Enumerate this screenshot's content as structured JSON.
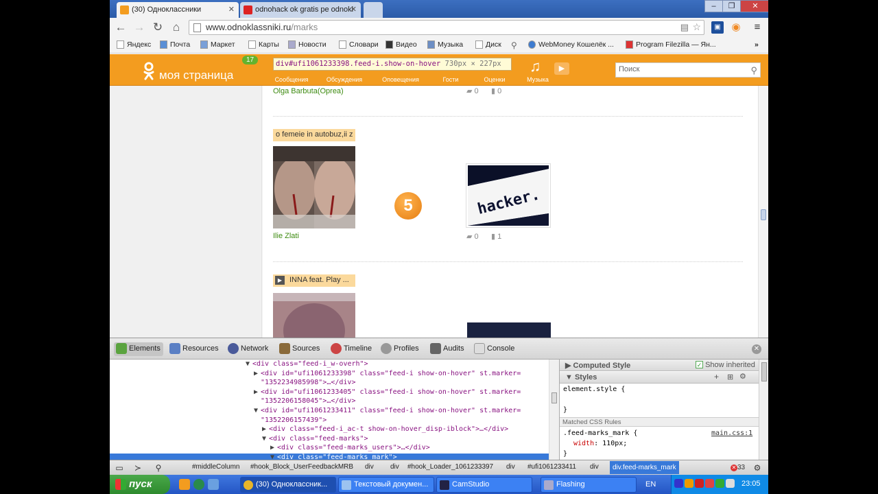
{
  "browser": {
    "tabs": [
      {
        "title": "(30) Одноклассники",
        "active": true
      },
      {
        "title": "odnohack ok gratis pe odnokl",
        "active": false
      }
    ],
    "url_host": "www.odnoklassniki.ru",
    "url_path": "/marks",
    "bookmarks": [
      "Яндекс",
      "Почта",
      "Маркет",
      "Карты",
      "Новости",
      "Словари",
      "Видео",
      "Музыка",
      "Диск",
      "WebMoney Кошелёк ...",
      "Program Filezilla — Ян..."
    ],
    "overflow_label": "»"
  },
  "ok": {
    "logo_text": "моя страница",
    "badge": "17",
    "nav": [
      "Сообщения",
      "Обсуждения",
      "Оповещения",
      "Гости",
      "Оценки",
      "Музыка"
    ],
    "search_placeholder": "Поиск",
    "inspector_tip": {
      "selector": "div#ufi1061233398.feed-i.show-on-hover",
      "size": "730px × 227px"
    }
  },
  "feed": {
    "item0": {
      "author": "Olga Barbuta(Oprea)",
      "comments": "0",
      "likes": "0"
    },
    "item1": {
      "caption": "o femeie in autobuz,ii z",
      "author": "Ilie Zlati",
      "mark": "5",
      "comments": "0",
      "likes": "1",
      "thumb_text": "hacker."
    },
    "item2": {
      "caption": "INNA feat. Play ..."
    }
  },
  "devtools": {
    "tabs": [
      "Elements",
      "Resources",
      "Network",
      "Sources",
      "Timeline",
      "Profiles",
      "Audits",
      "Console"
    ],
    "dom": [
      {
        "indent": 198,
        "tri": "▼",
        "html": "<div class=\"feed-i_w-overh\">"
      },
      {
        "indent": 210,
        "tri": "▶",
        "html": "<div id=\"ufi1061233398\" class=\"feed-i show-on-hover\" st.marker="
      },
      {
        "indent": 210,
        "tri": "",
        "html": "\"1352234985998\">…</div>"
      },
      {
        "indent": 210,
        "tri": "▶",
        "html": "<div id=\"ufi1061233405\" class=\"feed-i show-on-hover\" st.marker="
      },
      {
        "indent": 210,
        "tri": "",
        "html": "\"1352206158045\">…</div>"
      },
      {
        "indent": 210,
        "tri": "▼",
        "html": "<div id=\"ufi1061233411\" class=\"feed-i show-on-hover\" st.marker="
      },
      {
        "indent": 210,
        "tri": "",
        "html": "\"1352206157439\">"
      },
      {
        "indent": 222,
        "tri": "▶",
        "html": "<div class=\"feed-i_ac-t show-on-hover_disp-iblock\">…</div>"
      },
      {
        "indent": 222,
        "tri": "▼",
        "html": "<div class=\"feed-marks\">"
      },
      {
        "indent": 234,
        "tri": "▶",
        "html": "<div class=\"feed-marks_users\">…</div>"
      },
      {
        "indent": 234,
        "tri": "▼",
        "html": "<div class=\"feed-marks_mark\">"
      }
    ],
    "styles": {
      "computed_label": "Computed Style",
      "show_inherited": "Show inherited",
      "styles_label": "Styles",
      "element_style": "element.style {",
      "close_brace": "}",
      "matched_label": "Matched CSS Rules",
      "rule_selector": ".feed-marks_mark {",
      "rule_source": "main.css:1",
      "rule_prop": "width",
      "rule_val": "110px;"
    },
    "breadcrumbs": [
      "#middleColumn",
      "#hook_Block_UserFeedbackMRB",
      "div",
      "div",
      "#hook_Loader_1061233397",
      "div",
      "#ufi1061233411",
      "div",
      "div.feed-marks_mark"
    ],
    "error_count": "33"
  },
  "taskbar": {
    "start": "пуск",
    "tasks": [
      "(30) Одноклассник...",
      "Текстовый докумен...",
      "CamStudio",
      "Flashing"
    ],
    "lang": "EN",
    "clock": "23:05"
  }
}
